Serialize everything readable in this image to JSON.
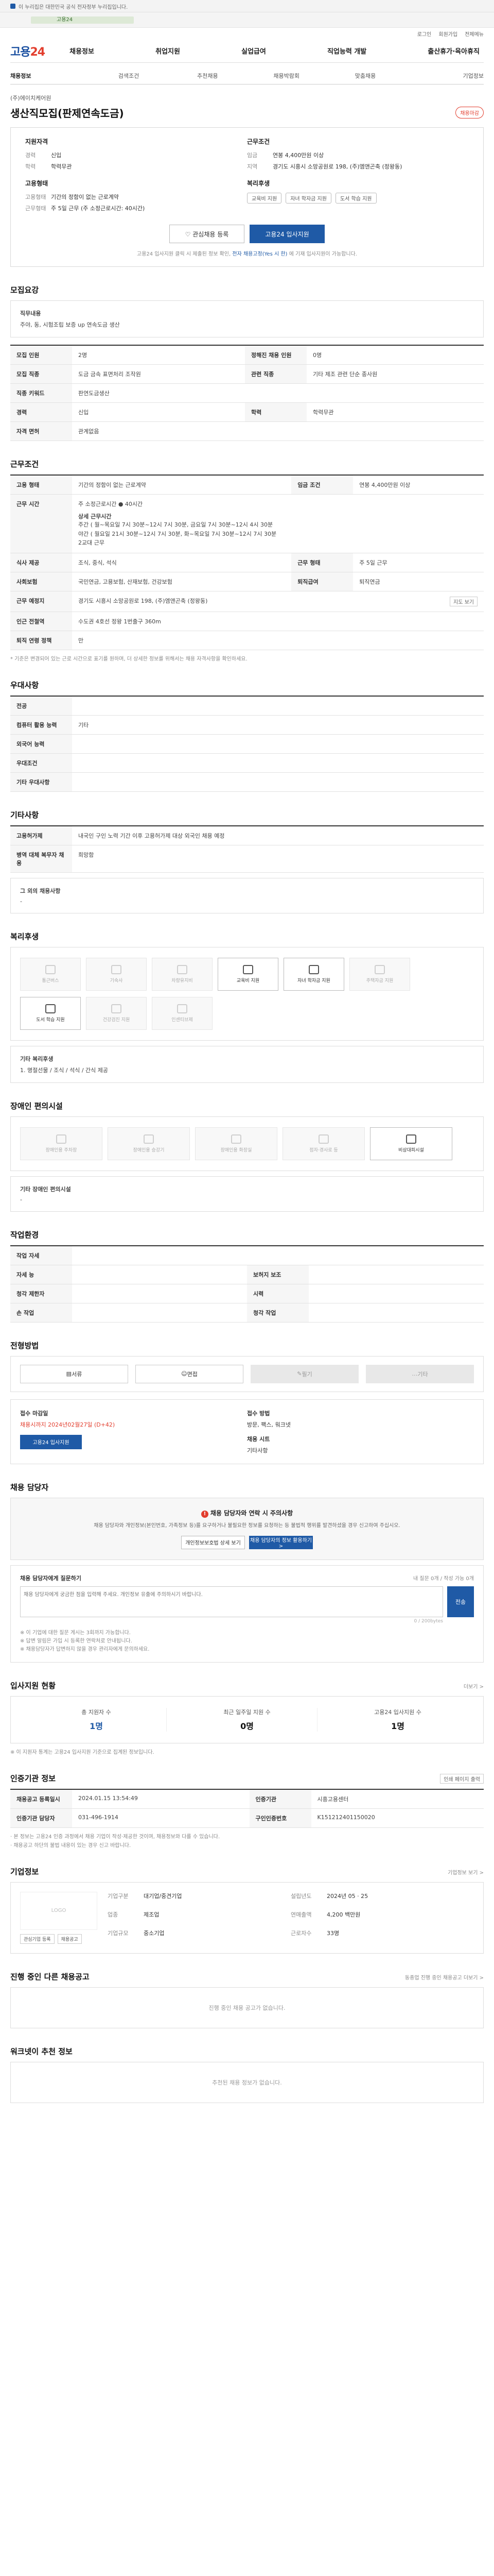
{
  "topbar": {
    "text": "이 누리집은 대한민국 공식 전자정부 누리집입니다."
  },
  "banner": {
    "text": "고용24"
  },
  "utilnav": [
    "로그인",
    "회원가입",
    "전체메뉴"
  ],
  "gnb": {
    "logo_a": "고용",
    "logo_b": "24",
    "menu": [
      "채용정보",
      "취업지원",
      "실업급여",
      "직업능력 개발",
      "출산휴가·육아휴직"
    ]
  },
  "subnav": [
    "채용정보",
    "검색조건",
    "추천채용",
    "채용박람회",
    "맞춤채용",
    "기업정보"
  ],
  "job": {
    "company": "(주)에이치케어원",
    "title": "생산직모집(판제연속도금)",
    "badge": "채용마감",
    "left_heading": "지원자격",
    "left_kv": [
      {
        "k": "경력",
        "v": "신입"
      },
      {
        "k": "학력",
        "v": "학력무관"
      }
    ],
    "right_heading": "근무조건",
    "right_kv": [
      {
        "k": "임금",
        "v": "연봉 4,400만원 이상"
      },
      {
        "k": "지역",
        "v": "경기도 시흥시 소망공원로 198, (주)엠앤곤축 (정왕동)"
      }
    ],
    "left2_heading": "고용형태",
    "left2_kv": [
      {
        "k": "고용형태",
        "v": "기간의 정함이 없는 근로계약"
      },
      {
        "k": "근무형태",
        "v": "주 5일 근무 (주 소정근로시간: 40시간)"
      }
    ],
    "right2_heading": "복리후생",
    "welfare_chips": [
      "교육비 지원",
      "자녀 학자금 지원",
      "도서 학습 지원"
    ],
    "btn_interest": "관심채용 등록",
    "btn_apply": "고용24 입사지원",
    "notice_a": "고용24 입사지원 클릭 시 제출된 정보 확인, ",
    "notice_b": "전자 채용고정(Yes 시 한)",
    "notice_c": " 에 기재 입사지원이 가능합니다."
  },
  "duty": {
    "title": "모집요강",
    "heading": "직무내용",
    "text": "주야, 동, 시험조립 보증 up 연속도금 생산"
  },
  "recruit": {
    "rows": [
      [
        "모집 인원",
        "2명",
        "정해진 채용 인원",
        "0명"
      ],
      [
        "모집 직종",
        "도금 금속 표면처리 조작원",
        "관련 직종",
        "기타 제조 관련 단순 종사원"
      ],
      [
        "직종 키워드",
        "판연도금생산",
        "",
        ""
      ],
      [
        "경력",
        "신입",
        "학력",
        "학력무관"
      ],
      [
        "자격 면허",
        "관계없음",
        "",
        ""
      ]
    ]
  },
  "conditions": {
    "title": "근무조건",
    "employment_type": "기간의 정함이 없는 근로계약",
    "wage_label": "임금 조건",
    "wage": "연봉 4,400만원 이상",
    "weekly_hours": "주 소정근로시간 ● 40시간",
    "schedule_heading": "상세 근무시간",
    "schedule": "주간 ( 월~목요일 7시 30분~12시 7시 30분,  금요일 7시 30분~12시 4시 30분\n야간 ( 월요일 21시 30분~12시 7시 30분, 화~목요일 7시 30분~12시 7시 30분\n2교대 근무",
    "meals_label": "식사 제공",
    "meals": "조식, 중식, 석식",
    "form_label": "근무 형태",
    "form": "주 5일 근무",
    "insurance_label": "사회보험",
    "insurance": "국민연금, 고용보험, 산재보험, 건강보험",
    "severance_label": "퇴직급여",
    "severance": "퇴직연금",
    "address_label": "근무 예정지",
    "address": "경기도 시흥시 소망공원로 198, (주)엠앤곤축 (정왕동)",
    "map_btn": "지도 보기",
    "transit_label": "인근 전철역",
    "transit": "수도권 4호선 정왕 1번출구 360m",
    "retire_label": "퇴직 연령 정책",
    "retire": "만",
    "footnote": "* 기준은 변경되어 있는 근로 시간으로 표기를 원하며, 더 상세한 정보를 위해서는 채용 자격사항을 확인하세요."
  },
  "selection": {
    "title": "우대사항",
    "rows": [
      [
        "전공",
        ""
      ],
      [
        "컴퓨터 활용 능력",
        "기타"
      ],
      [
        "외국어 능력",
        ""
      ],
      [
        "우대조건",
        ""
      ],
      [
        "기타 우대사항",
        ""
      ]
    ]
  },
  "corp_info": {
    "title": "기타사항",
    "rows": [
      [
        "고용허가제",
        "내국인 구인 노력 기간 이후 고용허가제 대상 외국인 채용 예정"
      ],
      [
        "병역 대체 복무자 채용",
        "희망함"
      ]
    ],
    "other_heading": "그 외의 채용사항",
    "other": "-"
  },
  "welfare": {
    "title": "복리후생",
    "items": [
      {
        "label": "통근버스",
        "on": false
      },
      {
        "label": "기숙사",
        "on": false
      },
      {
        "label": "차량유지비",
        "on": false
      },
      {
        "label": "교육비 지원",
        "on": true
      },
      {
        "label": "자녀 학자금 지원",
        "on": true
      },
      {
        "label": "주택자금 지원",
        "on": false
      },
      {
        "label": "도서 학습 지원",
        "on": true
      },
      {
        "label": "건강검진 지원",
        "on": false
      },
      {
        "label": "인센티브제",
        "on": false
      }
    ],
    "extra_heading": "기타 복리후생",
    "extra": "1. 명절선물 / 조식 / 석식 / 간식 제공"
  },
  "disability": {
    "title": "장애인 편의시설",
    "items": [
      {
        "label": "장애인용 주차장",
        "on": false
      },
      {
        "label": "장애인용 승강기",
        "on": false
      },
      {
        "label": "장애인용 화장실",
        "on": false
      },
      {
        "label": "점자·경사로 등",
        "on": false
      },
      {
        "label": "비상대피시설",
        "on": true
      }
    ],
    "extra_heading": "기타 장애인 편의시설",
    "extra": "-"
  },
  "work_env": {
    "title": "작업환경",
    "rows": [
      [
        "작업 자세",
        "",
        "",
        ""
      ],
      [
        "자세 능",
        "",
        "보허지 보조",
        ""
      ],
      [
        "청각 제한자",
        "",
        "시력",
        ""
      ],
      [
        "손 작업",
        "",
        "청각 작업",
        ""
      ]
    ]
  },
  "process": {
    "title": "전형방법",
    "steps": [
      {
        "label": "서류",
        "on": true
      },
      {
        "label": "면접",
        "on": true
      },
      {
        "label": "필기",
        "on": false
      },
      {
        "label": "기타",
        "on": false
      }
    ]
  },
  "accept": {
    "deadline_heading": "접수 마감일",
    "deadline": "채용시까지 2024년02월27일 (D+42)",
    "btn": "고용24 입사지원",
    "method_heading": "접수 방법",
    "method": "방문, 팩스, 워크넷",
    "result_heading": "채용 시트",
    "result": "기타사항"
  },
  "contact": {
    "title": "채용 담당자",
    "warn_title": "채용 담당자와 연락 시 주의사항",
    "warn_text": "채용 담당자와 개인정보(본인번호, 가족정보 등)를 요구하거나 불필요한 정보를 요청하는 등 불법적 행위를 발견하셨을 경우 신고하여 주십시오.",
    "btn_guide": "개인정보보호법 상세 보기",
    "btn_report": "채용 담당자의 정보 활용하기 >",
    "inquiry_heading": "채용 담당자에게 질문하기",
    "inquiry_count": "내 질문 0개 / 작성 가능 0개",
    "inquiry_placeholder": "채용 담당자에게 궁금한 점을 입력해 주세요. 개인정보 유출에 주의하시기 바랍니다.",
    "inquiry_send": "전송",
    "inquiry_limit": "0 / 200bytes",
    "notes": [
      "※ 이 기업에 대한 질문 게시는 3회까지 가능합니다.",
      "※ 답변 알림은 가입 시 등록한 연락처로 안내됩니다.",
      "※ 채용담당자가 답변하지 않을 경우 관리자에게 문의하세요."
    ]
  },
  "apply_stats": {
    "title": "입사지원 현황",
    "more": "더보기 >",
    "items": [
      {
        "label": "총 지원자 수",
        "value": "1명",
        "blue": true
      },
      {
        "label": "최근 일주일 지원 수",
        "value": "0명",
        "blue": false
      },
      {
        "label": "고용24 입사지원 수",
        "value": "1명",
        "blue": false
      }
    ],
    "note": "※ 이 지원자 통계는 고용24 입사지원 기준으로 집계된 정보입니다."
  },
  "notice_info": {
    "title": "인증기관 정보",
    "btn_print": "인쇄 페이지 출력",
    "rows": [
      [
        "채용공고 등록일시",
        "2024.01.15 13:54:49",
        "인증기관",
        "시흥고용센터"
      ],
      [
        "인증기관 담당자",
        "031-496-1914",
        "구인인증번호",
        "K151212401150020"
      ]
    ],
    "notes": [
      "· 본 정보는 고용24 인증 과정에서 채용 기업이 작성·제공한 것이며, 채용정보와 다를 수 있습니다.",
      "· 채용공고 하단의 불법 내용이 있는 경우 신고 바랍니다."
    ]
  },
  "corp": {
    "title": "기업정보",
    "more": "기업정보 보기 >",
    "logo_placeholder": "LOGO",
    "btn_a": "관심기업 등록",
    "btn_b": "채용공고",
    "fields": [
      [
        "기업구분",
        "대기업/중견기업",
        "설립년도",
        "2024년 05 · 25"
      ],
      [
        "업종",
        "제조업",
        "연매출액",
        "4,200 백만원"
      ],
      [
        "기업규모",
        "중소기업",
        "근로자수",
        "33명"
      ]
    ]
  },
  "same_corp": {
    "title": "진행 중인 다른 채용공고",
    "more": "동종업 진행 중인 채용공고 더보기 >",
    "empty": "진행 중인 채용 공고가 없습니다."
  },
  "recommend": {
    "title": "워크넷이 추천 정보",
    "empty": "추천된 채용 정보가 없습니다."
  }
}
